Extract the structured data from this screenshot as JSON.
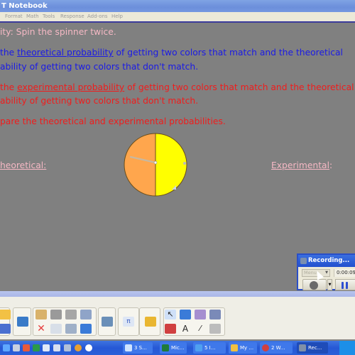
{
  "window": {
    "title": "T Notebook"
  },
  "menu": [
    "Format",
    "Math",
    "Tools",
    "Response",
    "Add-ons",
    "Help"
  ],
  "page": {
    "activity": "ity: Spin the spinner twice.",
    "task1": {
      "prefix": " the ",
      "link": "theoretical probability",
      "suffix": " of getting two colors that match and the theoretical",
      "line2": "ability of getting two colors that don't match."
    },
    "task2": {
      "prefix": " the ",
      "link": "experimental probability",
      "suffix": " of getting two colors that match and the theoretical",
      "line2": "ability of getting two colors that don't match."
    },
    "task3": "pare the theoretical and experimental probabilities.",
    "theoretical_label": "heoretical:",
    "experimental_label": "Experimental",
    "experimental_colon": ":"
  },
  "spinner": {
    "sections": [
      {
        "color": "#ffa64d",
        "fraction": 0.5
      },
      {
        "color": "#ffff00",
        "fraction": 0.5
      }
    ],
    "colors": {
      "outline": "#6b4e1a",
      "pointer": "#c8b8a0"
    }
  },
  "recorder": {
    "title": "Recording...",
    "menu_label": "Menu",
    "elapsed": "0:00:09"
  },
  "toolbar": {
    "groups": [
      "file",
      "display",
      "edit",
      "capture",
      "math",
      "info",
      "tools"
    ]
  },
  "taskbar": {
    "quick_launch": [
      "ie",
      "app2",
      "app3",
      "excel",
      "app5",
      "word",
      "app7",
      "chrome",
      "app9"
    ],
    "tasks": [
      {
        "label": "3 S...",
        "color": "#cfe4ff",
        "active": false
      },
      {
        "label": "Mic...",
        "color": "#1e7b3a",
        "active": false
      },
      {
        "label": "5 I...",
        "color": "#4fa0f0",
        "active": false
      },
      {
        "label": "My ...",
        "color": "#f0c040",
        "active": false
      },
      {
        "label": "2 W...",
        "color": "#d04040",
        "active": false
      },
      {
        "label": "Rec...",
        "color": "#8090a8",
        "active": true
      }
    ]
  }
}
